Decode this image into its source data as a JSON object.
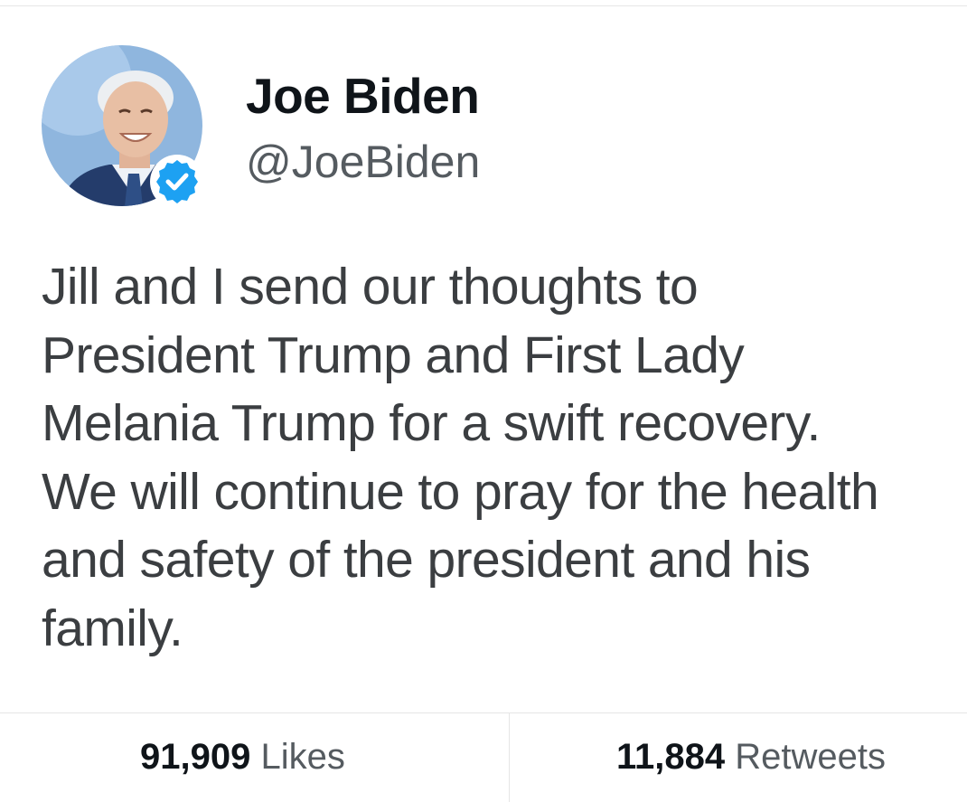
{
  "tweet": {
    "author": {
      "display_name": "Joe Biden",
      "handle": "@JoeBiden",
      "verified": true,
      "avatar_icon": "profile-photo",
      "verified_icon": "verified-badge-icon",
      "verified_color": "#1da1f2"
    },
    "text_lines": [
      "Jill and I send our thoughts to",
      "President Trump and First Lady",
      "Melania Trump for a swift recovery.",
      "We will continue to pray for the health",
      "and safety of the president and his",
      "family."
    ],
    "stats": {
      "likes_count": "91,909",
      "likes_label": "Likes",
      "retweets_count": "11,884",
      "retweets_label": "Retweets"
    }
  }
}
